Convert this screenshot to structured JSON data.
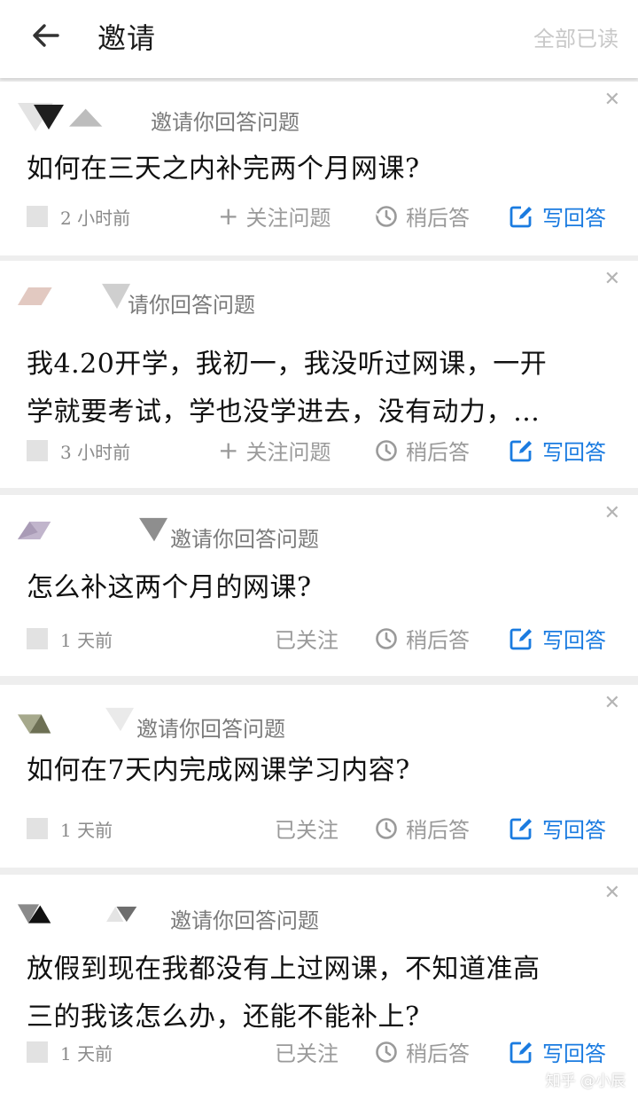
{
  "header": {
    "title": "邀请",
    "mark_all_read": "全部已读"
  },
  "cards": [
    {
      "invite_text": "邀请你回答问题",
      "question": "如何在三天之内补完两个月网课?",
      "time": "2 小时前",
      "follow_label": "关注问题",
      "later_label": "稍后答",
      "write_label": "写回答"
    },
    {
      "invite_text": "请你回答问题",
      "question_lines": [
        "我4.20开学，我初一，我没听过网课，一开",
        "学就要考试，学也没学进去，没有动力，…"
      ],
      "time": "3 小时前",
      "follow_label": "关注问题",
      "later_label": "稍后答",
      "write_label": "写回答"
    },
    {
      "invite_text": "邀请你回答问题",
      "question": "怎么补这两个月的网课?",
      "time": "1 天前",
      "follow_label": "已关注",
      "later_label": "稍后答",
      "write_label": "写回答"
    },
    {
      "invite_text": "邀请你回答问题",
      "question": "如何在7天内完成网课学习内容?",
      "time": "1 天前",
      "follow_label": "已关注",
      "later_label": "稍后答",
      "write_label": "写回答"
    },
    {
      "invite_text": "邀请你回答问题",
      "question_lines": [
        "放假到现在我都没有上过网课，不知道准高",
        "三的我该怎么办，还能不能补上?"
      ],
      "time": "1 天前",
      "follow_label": "已关注",
      "later_label": "稍后答",
      "write_label": "写回答"
    }
  ],
  "watermark": "知乎 @小辰",
  "colors": {
    "accent": "#1a7be0",
    "muted": "#9a9a9a",
    "background": "#eeeeee"
  },
  "icons": [
    "back-arrow-icon",
    "close-icon",
    "plus-icon",
    "clock-icon",
    "edit-icon"
  ]
}
